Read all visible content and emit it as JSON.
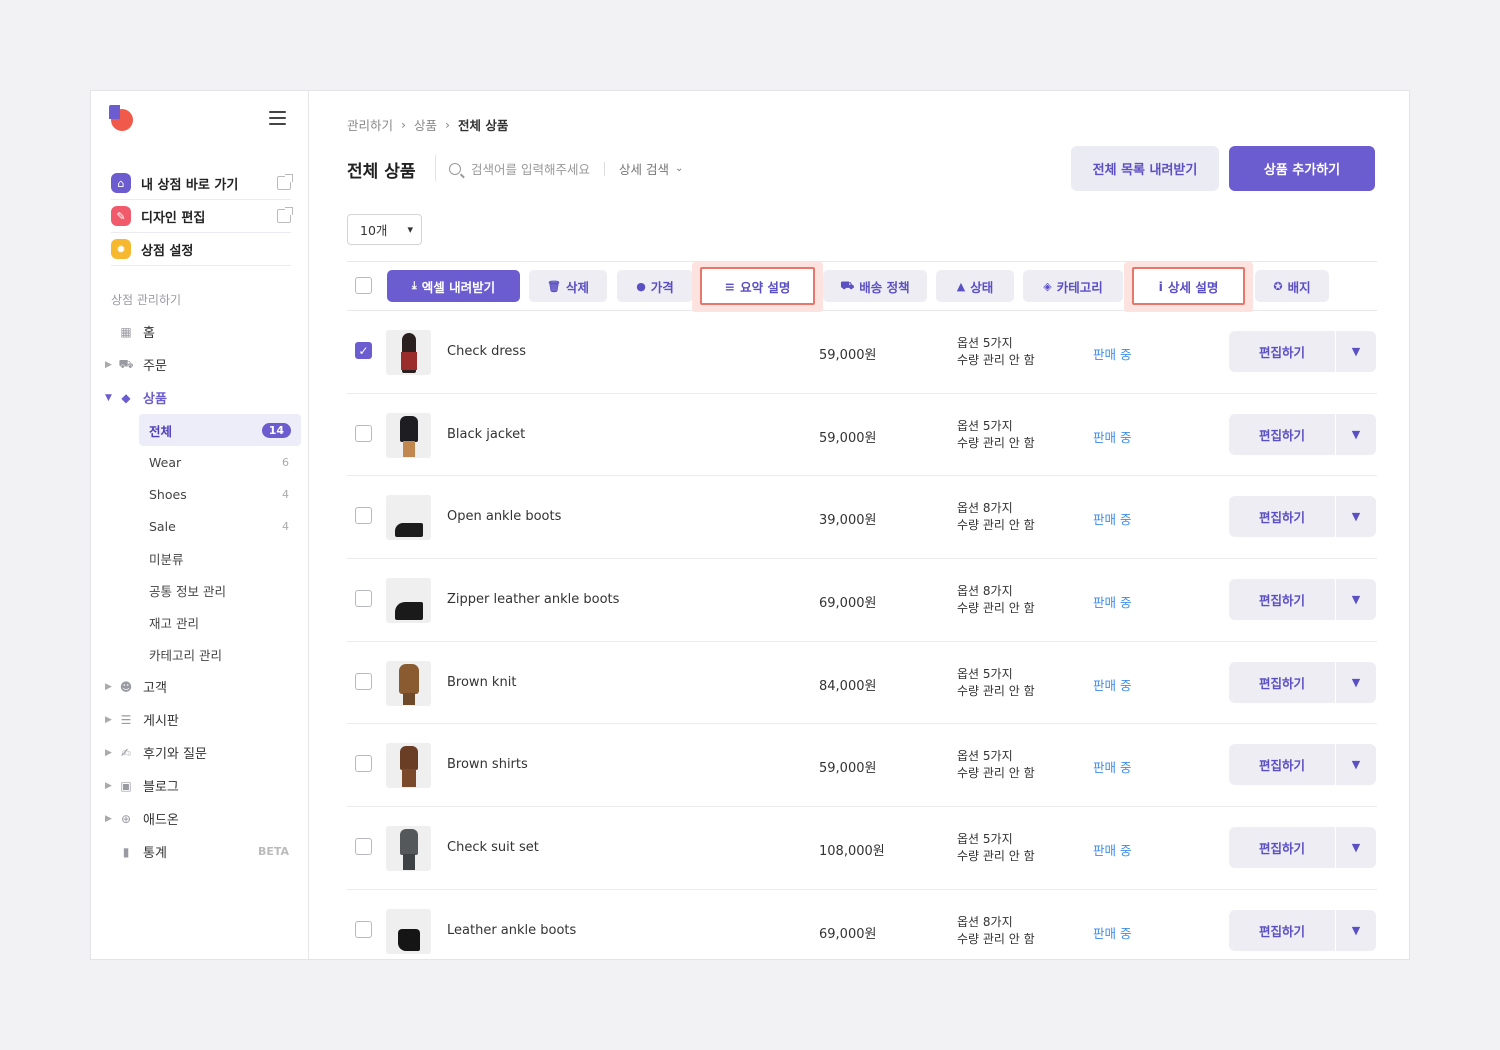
{
  "sidebar": {
    "quick": [
      {
        "label": "내 상점 바로 가기",
        "icon": "store-icon",
        "color": "#6b5ccf"
      },
      {
        "label": "디자인 편집",
        "icon": "pencil-icon",
        "color": "#f05a6a"
      },
      {
        "label": "상점 설정",
        "icon": "gear-icon",
        "color": "#f5b82e"
      }
    ],
    "section_title": "상점 관리하기",
    "nav": {
      "home": "홈",
      "orders": "주문",
      "products": "상품",
      "customers": "고객",
      "board": "게시판",
      "reviews": "후기와 질문",
      "blog": "블로그",
      "addons": "애드온",
      "stats": "통계",
      "stats_badge": "BETA"
    },
    "sub": [
      {
        "label": "전체",
        "count": "14"
      },
      {
        "label": "Wear",
        "count": "6"
      },
      {
        "label": "Shoes",
        "count": "4"
      },
      {
        "label": "Sale",
        "count": "4"
      },
      {
        "label": "미분류",
        "count": ""
      },
      {
        "label": "공통 정보 관리",
        "count": ""
      },
      {
        "label": "재고 관리",
        "count": ""
      },
      {
        "label": "카테고리 관리",
        "count": ""
      }
    ]
  },
  "breadcrumb": [
    "관리하기",
    "상품",
    "전체 상품"
  ],
  "header": {
    "title": "전체 상품",
    "search_placeholder": "검색어를 입력해주세요",
    "advanced_search": "상세 검색",
    "download_list": "전체 목록 내려받기",
    "add_product": "상품 추가하기"
  },
  "per_page": "10개",
  "toolbar": {
    "excel": "엑셀 내려받기",
    "delete": "삭제",
    "price": "가격",
    "summary": "요약 설명",
    "shipping": "배송 정책",
    "status": "상태",
    "category": "카테고리",
    "detail": "상세 설명",
    "badge": "배지"
  },
  "products": [
    {
      "name": "Check dress",
      "price": "59,000원",
      "opt1": "옵션 5가지",
      "opt2": "수량 관리 안 함",
      "status": "판매 중",
      "checked": true
    },
    {
      "name": "Black jacket",
      "price": "59,000원",
      "opt1": "옵션 5가지",
      "opt2": "수량 관리 안 함",
      "status": "판매 중",
      "checked": false
    },
    {
      "name": "Open ankle boots",
      "price": "39,000원",
      "opt1": "옵션 8가지",
      "opt2": "수량 관리 안 함",
      "status": "판매 중",
      "checked": false
    },
    {
      "name": "Zipper leather ankle boots",
      "price": "69,000원",
      "opt1": "옵션 8가지",
      "opt2": "수량 관리 안 함",
      "status": "판매 중",
      "checked": false
    },
    {
      "name": "Brown knit",
      "price": "84,000원",
      "opt1": "옵션 5가지",
      "opt2": "수량 관리 안 함",
      "status": "판매 중",
      "checked": false
    },
    {
      "name": "Brown shirts",
      "price": "59,000원",
      "opt1": "옵션 5가지",
      "opt2": "수량 관리 안 함",
      "status": "판매 중",
      "checked": false
    },
    {
      "name": "Check suit set",
      "price": "108,000원",
      "opt1": "옵션 5가지",
      "opt2": "수량 관리 안 함",
      "status": "판매 중",
      "checked": false
    },
    {
      "name": "Leather ankle boots",
      "price": "69,000원",
      "opt1": "옵션 8가지",
      "opt2": "수량 관리 안 함",
      "status": "판매 중",
      "checked": false
    }
  ],
  "edit_label": "편집하기",
  "colors": {
    "accent": "#6b5ccf",
    "status": "#3f8ee8",
    "highlight": "#e8776b"
  }
}
